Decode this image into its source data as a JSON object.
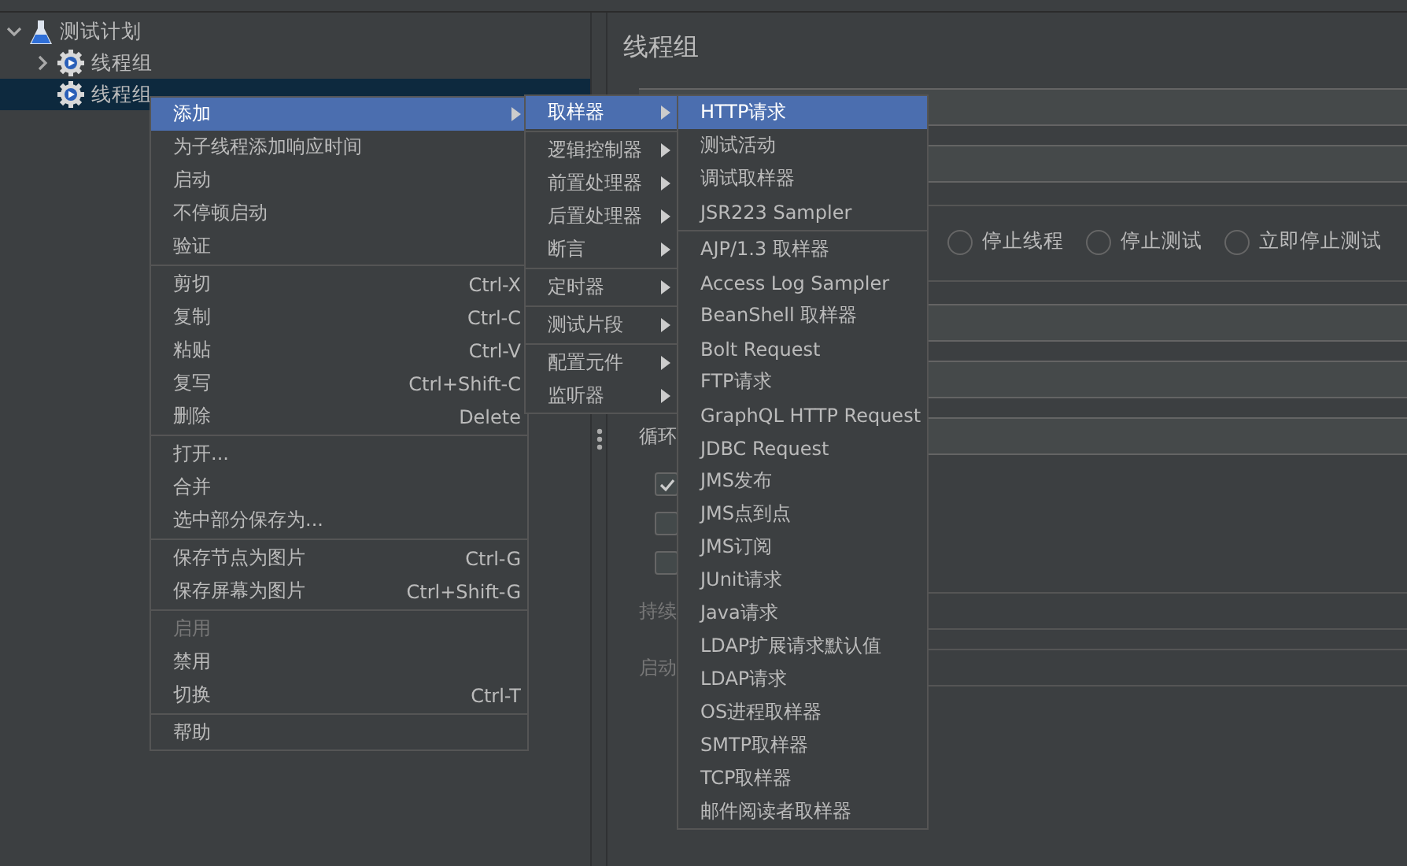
{
  "tree": [
    {
      "label": "测试计划",
      "kind": "plan",
      "expanded": true,
      "selected": false,
      "children": [
        {
          "label": "线程组",
          "kind": "thread-group",
          "expanded": false,
          "expandable": true,
          "selected": false
        },
        {
          "label": "线程组",
          "kind": "thread-group",
          "expanded": false,
          "expandable": false,
          "selected": true
        }
      ]
    }
  ],
  "panel": {
    "title": "线程组",
    "rows": [
      {
        "kind": "field"
      },
      {
        "kind": "field"
      },
      {
        "kind": "radios",
        "options": [
          {
            "label": "停止线程",
            "selected": false
          },
          {
            "label": "停止测试",
            "selected": false
          },
          {
            "label": "立即停止测试",
            "selected": false
          }
        ]
      },
      {
        "kind": "field"
      },
      {
        "kind": "field"
      },
      {
        "kind": "labeled-field",
        "label": "循环",
        "disabled": false
      },
      {
        "kind": "checkbox",
        "checked": true
      },
      {
        "kind": "checkbox",
        "checked": false
      },
      {
        "kind": "checkbox",
        "checked": false
      },
      {
        "kind": "labeled-field",
        "label": "持续",
        "disabled": true
      },
      {
        "kind": "labeled-field",
        "label": "启动",
        "disabled": true
      }
    ]
  },
  "menus": [
    {
      "groups": [
        [
          {
            "label": "添加",
            "submenu": true,
            "selected": true,
            "disabled": false
          },
          {
            "label": "为子线程添加响应时间",
            "submenu": false,
            "selected": false,
            "disabled": false
          },
          {
            "label": "启动",
            "submenu": false,
            "selected": false,
            "disabled": false
          },
          {
            "label": "不停顿启动",
            "submenu": false,
            "selected": false,
            "disabled": false
          },
          {
            "label": "验证",
            "submenu": false,
            "selected": false,
            "disabled": false
          }
        ],
        [
          {
            "label": "剪切",
            "shortcut": "Ctrl-X",
            "submenu": false,
            "selected": false,
            "disabled": false
          },
          {
            "label": "复制",
            "shortcut": "Ctrl-C",
            "submenu": false,
            "selected": false,
            "disabled": false
          },
          {
            "label": "粘贴",
            "shortcut": "Ctrl-V",
            "submenu": false,
            "selected": false,
            "disabled": false
          },
          {
            "label": "复写",
            "shortcut": "Ctrl+Shift-C",
            "submenu": false,
            "selected": false,
            "disabled": false
          },
          {
            "label": "删除",
            "shortcut": "Delete",
            "submenu": false,
            "selected": false,
            "disabled": false
          }
        ],
        [
          {
            "label": "打开...",
            "submenu": false,
            "selected": false,
            "disabled": false
          },
          {
            "label": "合并",
            "submenu": false,
            "selected": false,
            "disabled": false
          },
          {
            "label": "选中部分保存为...",
            "submenu": false,
            "selected": false,
            "disabled": false
          }
        ],
        [
          {
            "label": "保存节点为图片",
            "shortcut": "Ctrl-G",
            "submenu": false,
            "selected": false,
            "disabled": false
          },
          {
            "label": "保存屏幕为图片",
            "shortcut": "Ctrl+Shift-G",
            "submenu": false,
            "selected": false,
            "disabled": false
          }
        ],
        [
          {
            "label": "启用",
            "submenu": false,
            "selected": false,
            "disabled": true
          },
          {
            "label": "禁用",
            "submenu": false,
            "selected": false,
            "disabled": false
          },
          {
            "label": "切换",
            "shortcut": "Ctrl-T",
            "submenu": false,
            "selected": false,
            "disabled": false
          }
        ],
        [
          {
            "label": "帮助",
            "submenu": false,
            "selected": false,
            "disabled": false
          }
        ]
      ]
    },
    {
      "groups": [
        [
          {
            "label": "取样器",
            "submenu": true,
            "selected": true,
            "disabled": false
          }
        ],
        [
          {
            "label": "逻辑控制器",
            "submenu": true,
            "selected": false,
            "disabled": false
          },
          {
            "label": "前置处理器",
            "submenu": true,
            "selected": false,
            "disabled": false
          },
          {
            "label": "后置处理器",
            "submenu": true,
            "selected": false,
            "disabled": false
          },
          {
            "label": "断言",
            "submenu": true,
            "selected": false,
            "disabled": false
          }
        ],
        [
          {
            "label": "定时器",
            "submenu": true,
            "selected": false,
            "disabled": false
          }
        ],
        [
          {
            "label": "测试片段",
            "submenu": true,
            "selected": false,
            "disabled": false
          }
        ],
        [
          {
            "label": "配置元件",
            "submenu": true,
            "selected": false,
            "disabled": false
          },
          {
            "label": "监听器",
            "submenu": true,
            "selected": false,
            "disabled": false
          }
        ]
      ]
    },
    {
      "groups": [
        [
          {
            "label": "HTTP请求",
            "submenu": false,
            "selected": true,
            "disabled": false
          },
          {
            "label": "测试活动",
            "submenu": false,
            "selected": false,
            "disabled": false
          },
          {
            "label": "调试取样器",
            "submenu": false,
            "selected": false,
            "disabled": false
          },
          {
            "label": "JSR223 Sampler",
            "submenu": false,
            "selected": false,
            "disabled": false
          }
        ],
        [
          {
            "label": "AJP/1.3 取样器",
            "submenu": false,
            "selected": false,
            "disabled": false
          },
          {
            "label": "Access Log Sampler",
            "submenu": false,
            "selected": false,
            "disabled": false
          },
          {
            "label": "BeanShell 取样器",
            "submenu": false,
            "selected": false,
            "disabled": false
          },
          {
            "label": "Bolt Request",
            "submenu": false,
            "selected": false,
            "disabled": false
          },
          {
            "label": "FTP请求",
            "submenu": false,
            "selected": false,
            "disabled": false
          },
          {
            "label": "GraphQL HTTP Request",
            "submenu": false,
            "selected": false,
            "disabled": false
          },
          {
            "label": "JDBC Request",
            "submenu": false,
            "selected": false,
            "disabled": false
          },
          {
            "label": "JMS发布",
            "submenu": false,
            "selected": false,
            "disabled": false
          },
          {
            "label": "JMS点到点",
            "submenu": false,
            "selected": false,
            "disabled": false
          },
          {
            "label": "JMS订阅",
            "submenu": false,
            "selected": false,
            "disabled": false
          },
          {
            "label": "JUnit请求",
            "submenu": false,
            "selected": false,
            "disabled": false
          },
          {
            "label": "Java请求",
            "submenu": false,
            "selected": false,
            "disabled": false
          },
          {
            "label": "LDAP扩展请求默认值",
            "submenu": false,
            "selected": false,
            "disabled": false
          },
          {
            "label": "LDAP请求",
            "submenu": false,
            "selected": false,
            "disabled": false
          },
          {
            "label": "OS进程取样器",
            "submenu": false,
            "selected": false,
            "disabled": false
          },
          {
            "label": "SMTP取样器",
            "submenu": false,
            "selected": false,
            "disabled": false
          },
          {
            "label": "TCP取样器",
            "submenu": false,
            "selected": false,
            "disabled": false
          },
          {
            "label": "邮件阅读者取样器",
            "submenu": false,
            "selected": false,
            "disabled": false
          }
        ]
      ]
    }
  ]
}
